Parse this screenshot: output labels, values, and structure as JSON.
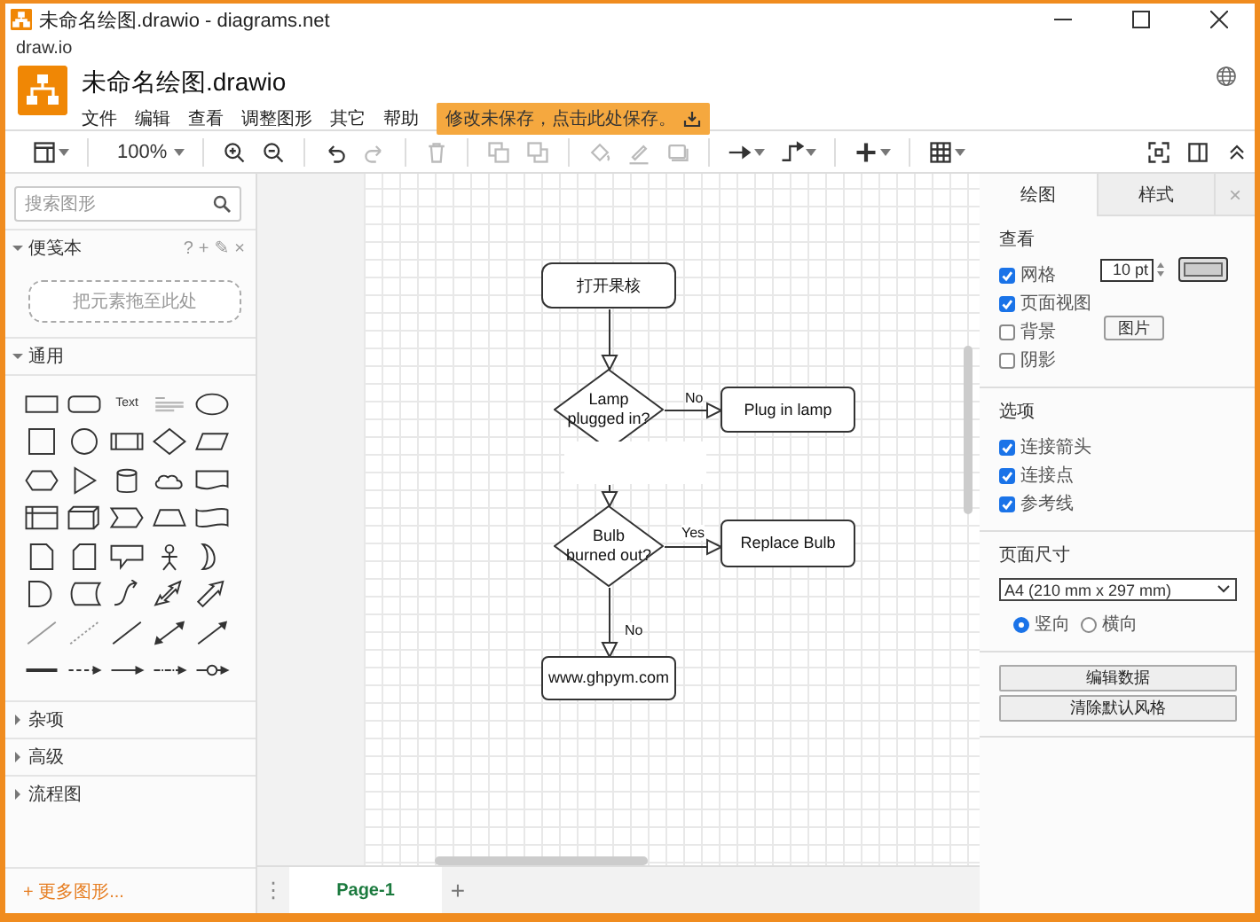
{
  "window": {
    "title": "未命名绘图.drawio - diagrams.net",
    "app_label": "draw.io"
  },
  "header": {
    "file_name": "未命名绘图.drawio",
    "menus": [
      "文件",
      "编辑",
      "查看",
      "调整图形",
      "其它",
      "帮助"
    ],
    "save_notice": "修改未保存，点击此处保存。"
  },
  "toolbar": {
    "zoom": "100%",
    "buttons": [
      {
        "kind": "zoom_in",
        "disabled": false
      },
      {
        "kind": "zoom_out",
        "disabled": false
      },
      {
        "kind": "undo",
        "disabled": false
      },
      {
        "kind": "redo",
        "disabled": true
      },
      {
        "kind": "delete",
        "disabled": true
      },
      {
        "kind": "to_front",
        "disabled": true
      },
      {
        "kind": "to_back",
        "disabled": true
      },
      {
        "kind": "fill",
        "disabled": true
      },
      {
        "kind": "line",
        "disabled": true
      },
      {
        "kind": "shadow",
        "disabled": true
      },
      {
        "kind": "connection",
        "disabled": false
      },
      {
        "kind": "waypoints",
        "disabled": false
      },
      {
        "kind": "insert",
        "disabled": false
      },
      {
        "kind": "table",
        "disabled": false
      }
    ]
  },
  "sidebar": {
    "search": {
      "placeholder": "搜索图形"
    },
    "sections": [
      {
        "kind": "scratchpad",
        "title": "便笺本",
        "expanded": true,
        "actions": [
          "?",
          "+",
          "✎",
          "×"
        ],
        "drop_hint": "把元素拖至此处"
      },
      {
        "kind": "palette",
        "title": "通用",
        "expanded": true,
        "text_shape": "Text"
      },
      {
        "kind": "plain",
        "title": "杂项",
        "expanded": false
      },
      {
        "kind": "plain",
        "title": "高级",
        "expanded": false
      },
      {
        "kind": "plain",
        "title": "流程图",
        "expanded": false
      }
    ],
    "more_shapes": "+ 更多图形..."
  },
  "diagram": {
    "nodes": [
      {
        "kind": "terminal",
        "label": "打开果核"
      },
      {
        "kind": "decision",
        "label": "Lamp\nplugged in?"
      },
      {
        "kind": "process",
        "label": "Plug in lamp"
      },
      {
        "kind": "decision",
        "label": "Bulb\nburned out?"
      },
      {
        "kind": "process",
        "label": "Replace Bulb"
      },
      {
        "kind": "process",
        "label": "www.ghpym.com"
      }
    ],
    "edge_labels": [
      "No",
      "Yes",
      "No"
    ]
  },
  "panel": {
    "tabs": [
      {
        "label": "绘图",
        "selected": true
      },
      {
        "label": "样式",
        "selected": false
      }
    ],
    "close": "×",
    "view": {
      "title": "查看",
      "options": [
        {
          "label": "网格",
          "checked": true
        },
        {
          "label": "页面视图",
          "checked": true
        },
        {
          "label": "背景",
          "checked": false
        },
        {
          "label": "阴影",
          "checked": false
        }
      ],
      "grid_size": "10 pt",
      "image_button": "图片"
    },
    "options": {
      "title": "选项",
      "options": [
        {
          "label": "连接箭头",
          "checked": true
        },
        {
          "label": "连接点",
          "checked": true
        },
        {
          "label": "参考线",
          "checked": true
        }
      ]
    },
    "paper": {
      "title": "页面尺寸",
      "size": "A4 (210 mm x 297 mm)",
      "orientations": [
        {
          "label": "竖向",
          "selected": true
        },
        {
          "label": "横向",
          "selected": false
        }
      ]
    },
    "buttons": [
      "编辑数据",
      "清除默认风格"
    ]
  },
  "pages": {
    "menu": "⋮",
    "tabs": [
      {
        "label": "Page-1",
        "selected": true
      }
    ],
    "add": "+"
  }
}
